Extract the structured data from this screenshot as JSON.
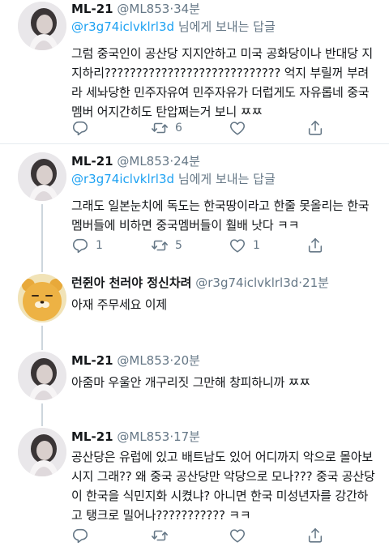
{
  "reply_prefix": "님에게 보내는 답글",
  "tweets": [
    {
      "name": "ML-21",
      "handle": "@ML853",
      "time": "34분",
      "reply_to": "@r3g74iclvklrl3d",
      "text": "그럼 중국인이 공산당 지지안하고 미국 공화당이나 반대당 지지하리????????????????????????????  억지 부릴꺼 부려라 세놔당한 민주자유여  민주자유가 더럽게도 자유롭네 중국멤버 어지간히도 탄압쩌는거 보니  ㅉㅉ",
      "counts": {
        "reply": "",
        "retweet": "6",
        "like": ""
      }
    },
    {
      "name": "ML-21",
      "handle": "@ML853",
      "time": "24분",
      "reply_to": "@r3g74iclvklrl3d",
      "text": "그래도 일본눈치에 독도는 한국땅이라고 한줄 못올리는 한국멤버들에 비하면 중국멤버들이 훨배 낫다 ㅋㅋ",
      "counts": {
        "reply": "1",
        "retweet": "5",
        "like": "1"
      }
    },
    {
      "name": "런쥔아 천러야 정신차려",
      "handle": "@r3g74iclvklrl3d",
      "time": "21분",
      "text": "아재 주무세요 이제"
    },
    {
      "name": "ML-21",
      "handle": "@ML853",
      "time": "20분",
      "text": "아줌마 우울안 개구리짓 그만해 창피하니까  ㅉㅉ",
      "counts": {
        "reply": "",
        "retweet": "",
        "like": ""
      }
    },
    {
      "name": "ML-21",
      "handle": "@ML853",
      "time": "17분",
      "text": "공산당은 유럽에 있고 배트남도 있어  어디까지 악으로 몰아보시지 그래??  왜 중국 공산당만 악당으로 모나???  중국 공산당이 한국을 식민지화 시켰냐? 아니면 한국 미성년자를 강간하고 탱크로 밀어나???????????  ㅋㅋ",
      "counts": {
        "reply": "",
        "retweet": "",
        "like": ""
      }
    }
  ],
  "icons": {
    "reply": "reply-icon",
    "retweet": "retweet-icon",
    "like": "heart-icon",
    "share": "share-icon"
  },
  "colors": {
    "text": "#14171a",
    "secondary": "#657786",
    "link": "#1da1f2",
    "separator": "#e6ecf0",
    "thread_line": "#cdd6dd"
  }
}
